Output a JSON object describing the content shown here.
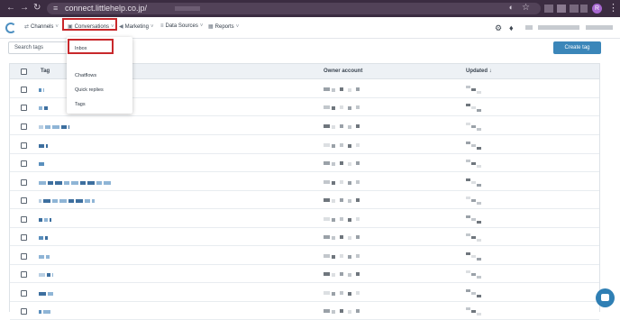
{
  "browser": {
    "url": "connect.littlehelp.co.jp/",
    "avatar_letter": "R"
  },
  "appbar": {
    "nav": [
      {
        "label": "Channels",
        "icon": "link-icon"
      },
      {
        "label": "Conversations",
        "icon": "chat-icon"
      },
      {
        "label": "Marketing",
        "icon": "megaphone-icon"
      },
      {
        "label": "Data Sources",
        "icon": "database-icon"
      },
      {
        "label": "Reports",
        "icon": "chart-icon"
      }
    ]
  },
  "toolbar": {
    "search_placeholder": "Search tags",
    "create_label": "Create tag"
  },
  "table": {
    "headers": {
      "tag": "Tag",
      "owner": "Owner account",
      "updated": "Updated ↓"
    }
  },
  "dropdown": {
    "items": [
      "Inbox",
      "Chatflows",
      "Quick replies",
      "Tags"
    ]
  },
  "colors": {
    "accent": "#3b86b9",
    "highlight": "#c8282b",
    "browser_frame": "#3b2c41"
  }
}
